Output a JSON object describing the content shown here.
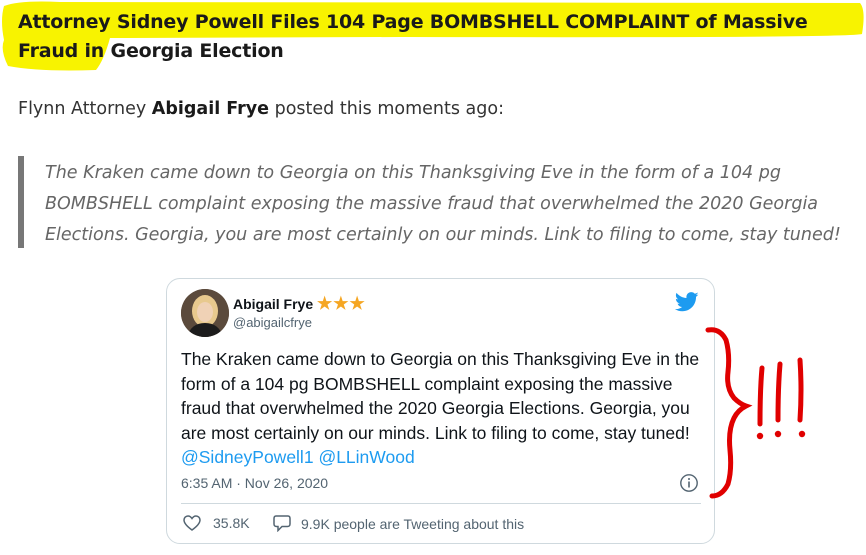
{
  "article": {
    "headline": "Attorney Sidney Powell Files 104 Page BOMBSHELL COMPLAINT of Massive Fraud in Georgia Election",
    "intro_prefix": "Flynn Attorney ",
    "intro_name": "Abigail Frye",
    "intro_suffix": " posted this moments ago:",
    "blockquote": "The Kraken came down to Georgia on this Thanksgiving Eve in the form of a 104 pg BOMBSHELL complaint exposing the massive fraud that overwhelmed the 2020 Georgia Elections. Georgia, you are most certainly on our minds. Link to filing to come, stay tuned!",
    "highlight_color": "#f8f300"
  },
  "tweet": {
    "author_name": "Abigail Frye",
    "author_stars": "★★★",
    "handle": "@abigailcfrye",
    "body": "The Kraken came down to Georgia on this Thanksgiving Eve in the form of a 104 pg BOMBSHELL complaint exposing the massive fraud that overwhelmed the 2020 Georgia Elections. Georgia, you are most certainly on our minds. Link to filing to come, stay tuned! ",
    "mention_1": "@SidneyPowell1",
    "mention_2": "@LLinWood",
    "timestamp": "6:35 AM · Nov 26, 2020",
    "likes": "35.8K",
    "replies_text": "9.9K people are Tweeting about this",
    "link_color": "#1d9bf0",
    "icons": [
      "twitter-bird-icon",
      "info-icon",
      "heart-icon",
      "speech-bubble-icon"
    ]
  },
  "annotation": {
    "text": "}!!!",
    "color": "#e00000"
  }
}
